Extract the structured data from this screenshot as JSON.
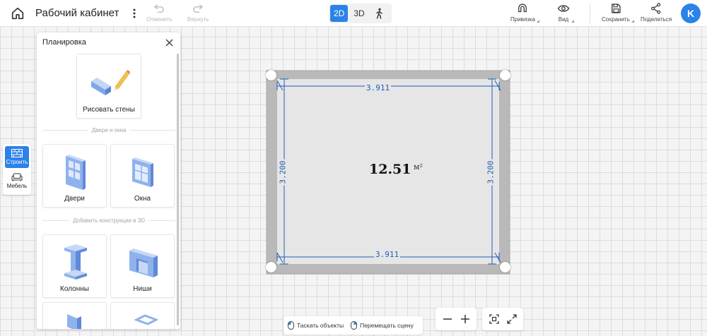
{
  "header": {
    "title": "Рабочий кабинет",
    "undo_label": "Отменить",
    "redo_label": "Вернуть",
    "view_modes": [
      "2D",
      "3D"
    ],
    "active_view": "2D",
    "snap_label": "Привязка",
    "view_label": "Вид",
    "save_label": "Сохранить",
    "share_label": "Поделиться",
    "avatar_initial": "K"
  },
  "rail": {
    "build_label": "Строить",
    "furniture_label": "Мебель"
  },
  "panel": {
    "title": "Планировка",
    "draw_walls_label": "Рисовать стены",
    "section_doors_windows": "Двери и окна",
    "doors_label": "Двери",
    "windows_label": "Окна",
    "section_3d": "Добавить конструкции в 3D",
    "columns_label": "Колонны",
    "niches_label": "Ниши"
  },
  "room": {
    "area": "12.51",
    "unit": "м²",
    "width_top": "3.911",
    "width_bottom": "3.911",
    "height_left": "3.200",
    "height_right": "3.200"
  },
  "hints": {
    "drag_objects": "Таскать объекты",
    "move_scene": "Перемещать сцену"
  },
  "colors": {
    "accent": "#2b82e8",
    "wall": "#b9b9b9",
    "floor": "#e6e6e6",
    "dimension": "#1f5db5"
  }
}
